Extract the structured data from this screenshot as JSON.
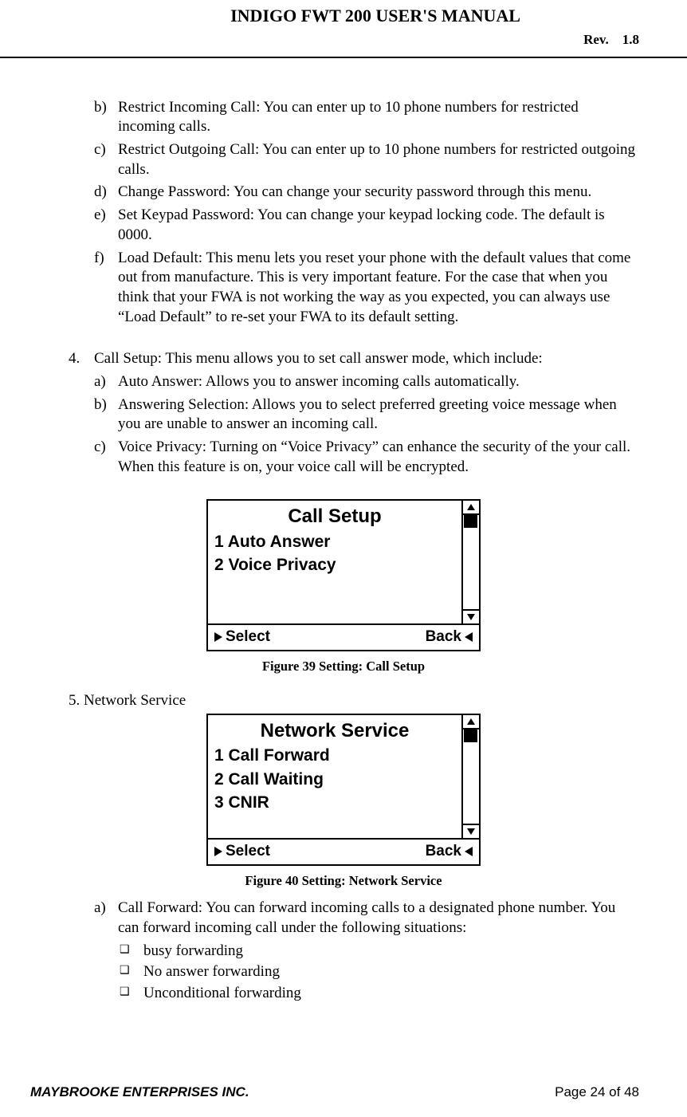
{
  "header": {
    "title": "INDIGO FWT 200 USER'S MANUAL",
    "rev_label": "Rev.",
    "rev_value": "1.8"
  },
  "body": {
    "items_lettered": [
      {
        "marker": "b)",
        "text": "Restrict Incoming Call: You can enter up to 10 phone numbers  for restricted incoming calls."
      },
      {
        "marker": "c)",
        "text": "Restrict Outgoing Call: You can enter up to 10 phone numbers  for restricted outgoing calls."
      },
      {
        "marker": "d)",
        "text": "Change Password: You can change your security password through this menu."
      },
      {
        "marker": "e)",
        "text": "Set Keypad Password: You can change your keypad locking code. The default is 0000."
      },
      {
        "marker": "f)",
        "text": "Load Default: This menu lets you  reset your phone with the default values that come out from manufacture. This is very important feature. For the case that when you think that your FWA is not working the way as you expected, you can always use “Load Default” to re-set your FWA to its default setting."
      }
    ],
    "num4": {
      "marker": "4.",
      "text": "Call Setup: This menu allows you to set call answer mode, which include:",
      "sub": [
        {
          "marker": "a)",
          "text": "Auto Answer: Allows you to answer incoming calls automatically."
        },
        {
          "marker": "b)",
          "text": "Answering Selection: Allows you to select preferred greeting voice message when you are unable to answer an incoming call."
        },
        {
          "marker": "c)",
          "text": "Voice Privacy: Turning on “Voice Privacy”  can enhance the security of the your call. When this feature is on, your voice call will be encrypted."
        }
      ]
    },
    "figure39": {
      "title": "Call Setup",
      "lines": [
        "1 Auto Answer",
        "",
        "2 Voice Privacy"
      ],
      "select": "Select",
      "back": "Back",
      "caption": "Figure 39 Setting: Call Setup"
    },
    "num5_text": "5. Network Service",
    "figure40": {
      "title": "Network Service",
      "lines": [
        "1 Call Forward",
        "2 Call Waiting",
        "3 CNIR"
      ],
      "select": "Select",
      "back": "Back",
      "caption": "Figure 40 Setting: Network Service"
    },
    "item_a": {
      "marker": "a)",
      "text": "Call Forward: You can forward incoming calls to a designated phone number. You can forward incoming call under the following situations:",
      "bullets": [
        "busy forwarding",
        "No answer forwarding",
        "Unconditional forwarding"
      ]
    }
  },
  "footer": {
    "company": "MAYBROOKE ENTERPRISES INC.",
    "page": "Page 24 of 48"
  }
}
